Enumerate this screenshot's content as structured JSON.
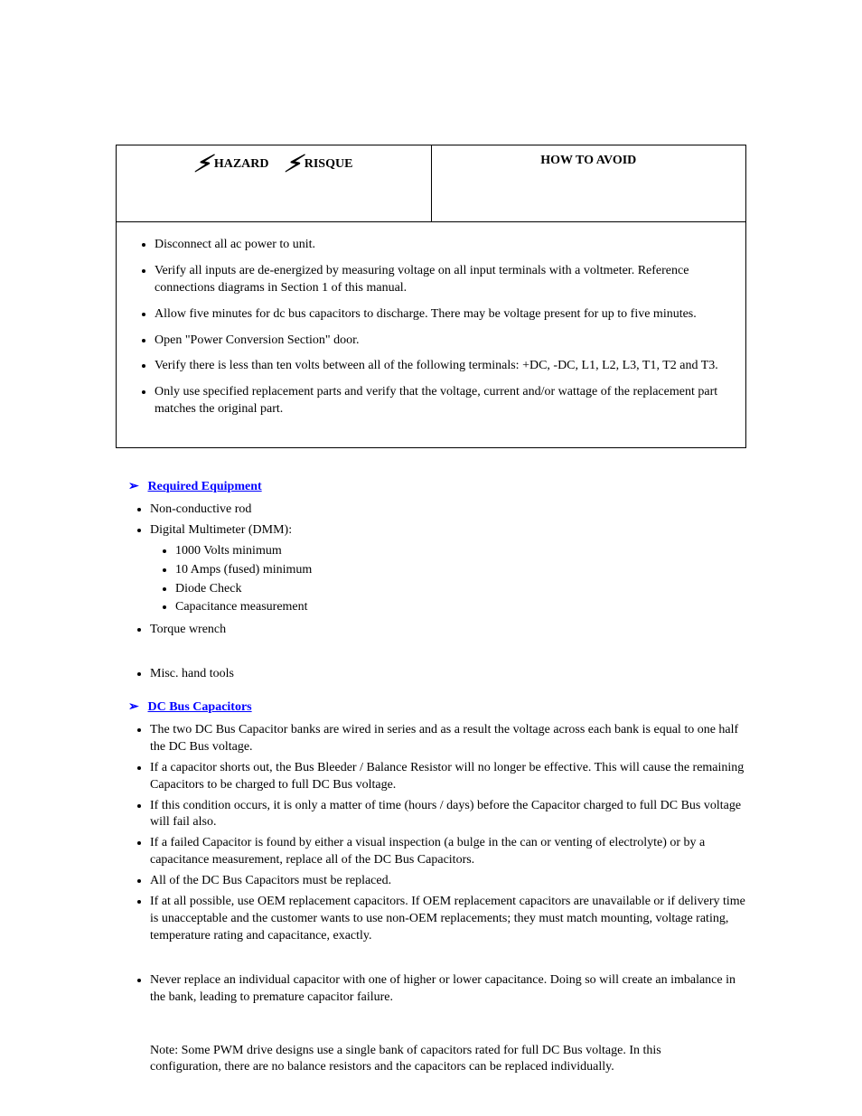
{
  "table": {
    "header_left_prefix": "HAZARD",
    "header_left_suffix": "RISQUE",
    "header_right": "HOW TO AVOID",
    "bullets": [
      "Disconnect all ac power to unit.",
      "Verify all inputs are de-energized by measuring voltage on all input terminals with a voltmeter. Reference connections diagrams in Section 1 of this manual.",
      "Allow five minutes for dc bus capacitors to discharge.  There may be voltage present for up to five minutes.",
      "Open \"Power Conversion Section\" door.",
      "Verify there is less than ten volts between all of the following terminals: +DC, -DC, L1, L2, L3, T1, T2 and T3.",
      "Only use specified replacement parts and verify that the voltage, current and/or wattage of the replacement part matches the original part."
    ]
  },
  "section1": {
    "title": "Required Equipment",
    "items": [
      "Non-conductive rod",
      "Digital Multimeter (DMM):",
      "Torque wrench",
      "Misc. hand tools"
    ],
    "dmm_specs": [
      "1000 Volts minimum",
      "10 Amps (fused) minimum",
      "Diode Check",
      "Capacitance measurement"
    ]
  },
  "section2": {
    "title": "DC Bus Capacitors",
    "items": [
      "The two DC Bus Capacitor banks are wired in series and as a result the voltage across each bank is equal to one half the DC Bus voltage.",
      "If a capacitor shorts out, the Bus Bleeder / Balance Resistor will no longer be effective.  This will cause the remaining Capacitors to be charged to full DC Bus voltage.",
      "If this condition occurs, it is only a matter of time (hours / days) before the Capacitor charged to full DC Bus voltage will fail also.",
      "If a failed Capacitor is found by either a visual inspection (a bulge in the can or venting of electrolyte) or by a capacitance measurement, replace all of the DC Bus Capacitors.",
      "All of the DC Bus Capacitors must be replaced.",
      "If at all possible, use OEM replacement capacitors.  If OEM replacement capacitors are unavailable or if delivery time is unacceptable and the customer wants to use non-OEM replacements; they must match mounting, voltage rating, temperature rating and capacitance, exactly.",
      "Never replace an individual capacitor with one of higher or lower capacitance. Doing so will create an imbalance in the bank, leading to premature capacitor failure."
    ]
  },
  "note": "Note:  Some PWM drive designs use a single bank of capacitors rated for full DC Bus voltage.  In this configuration, there are no balance resistors and the capacitors can be replaced individually."
}
